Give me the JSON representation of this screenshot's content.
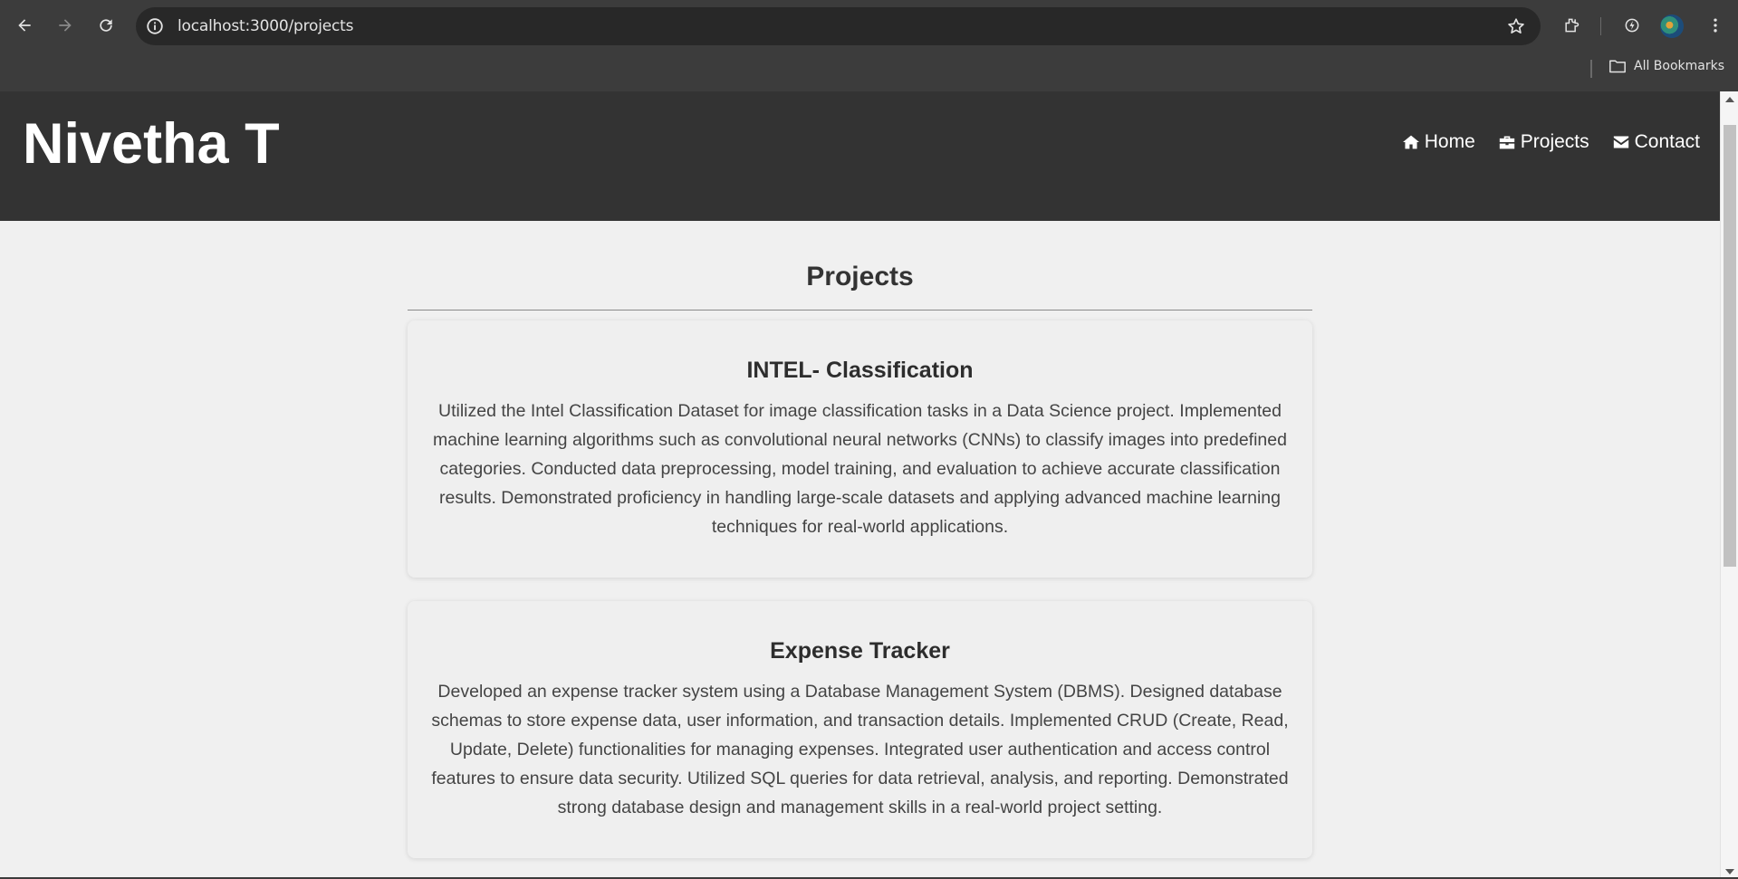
{
  "browser": {
    "url": "localhost:3000/projects",
    "bookmarks_label": "All Bookmarks",
    "icons": [
      "back-icon",
      "forward-icon",
      "reload-icon",
      "site-info-icon",
      "star-icon",
      "extensions-icon",
      "performance-icon",
      "menu-icon",
      "folder-icon"
    ]
  },
  "site": {
    "brand": "Nivetha T",
    "nav": [
      {
        "label": "Home",
        "icon": "home-icon"
      },
      {
        "label": "Projects",
        "icon": "briefcase-icon"
      },
      {
        "label": "Contact",
        "icon": "envelope-icon"
      }
    ]
  },
  "page": {
    "title": "Projects",
    "projects": [
      {
        "title": "INTEL- Classification",
        "description": "Utilized the Intel Classification Dataset for image classification tasks in a Data Science project. Implemented machine learning algorithms such as convolutional neural networks (CNNs) to classify images into predefined categories. Conducted data preprocessing, model training, and evaluation to achieve accurate classification results. Demonstrated proficiency in handling large-scale datasets and applying advanced machine learning techniques for real-world applications."
      },
      {
        "title": "Expense Tracker",
        "description": "Developed an expense tracker system using a Database Management System (DBMS). Designed database schemas to store expense data, user information, and transaction details. Implemented CRUD (Create, Read, Update, Delete) functionalities for managing expenses. Integrated user authentication and access control features to ensure data security. Utilized SQL queries for data retrieval, analysis, and reporting. Demonstrated strong database design and management skills in a real-world project setting."
      }
    ]
  },
  "colors": {
    "header_bg": "#333333",
    "page_bg": "#f0f0f0",
    "chrome_bg": "#3c3c3c"
  }
}
